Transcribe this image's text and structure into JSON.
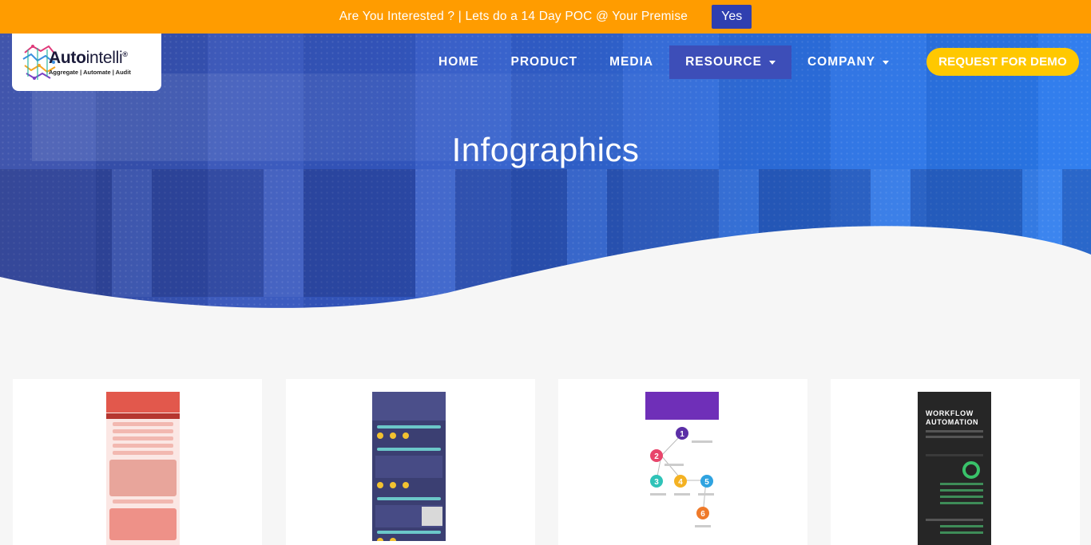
{
  "banner": {
    "text": "Are You Interested ? | Lets do a 14 Day POC @ Your Premise",
    "button_label": "Yes"
  },
  "logo": {
    "word_a": "Auto",
    "word_b": "intelli",
    "registered": "®",
    "tagline": "Aggregate | Automate | Audit"
  },
  "nav": {
    "items": [
      {
        "label": "HOME",
        "dropdown": false,
        "active": false
      },
      {
        "label": "PRODUCT",
        "dropdown": false,
        "active": false
      },
      {
        "label": "MEDIA",
        "dropdown": false,
        "active": false
      },
      {
        "label": "RESOURCE",
        "dropdown": true,
        "active": true
      },
      {
        "label": "COMPANY",
        "dropdown": true,
        "active": false
      }
    ],
    "cta_label": "REQUEST FOR DEMO"
  },
  "hero": {
    "title": "Infographics"
  },
  "colors": {
    "banner": "#ff9c00",
    "yes_button": "#2f3fb0",
    "cta": "#ffc800",
    "nav_active": "#3d4eb8",
    "page_bg": "#f6f6f6"
  },
  "infographics": {
    "card4_title": "WORKFLOW AUTOMATION",
    "card3_steps": [
      "1",
      "2",
      "3",
      "4",
      "5",
      "6"
    ]
  }
}
